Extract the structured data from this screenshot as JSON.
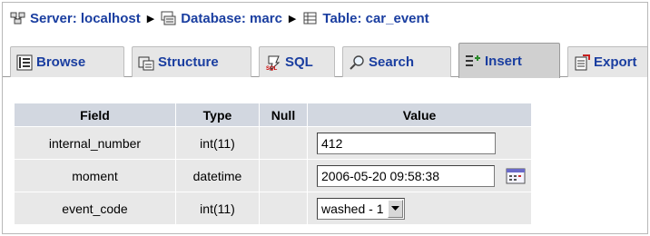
{
  "breadcrumb": {
    "server": "Server: localhost",
    "database": "Database: marc",
    "table": "Table: car_event"
  },
  "tabs": [
    {
      "label": "Browse",
      "icon": "browse-icon"
    },
    {
      "label": "Structure",
      "icon": "structure-icon"
    },
    {
      "label": "SQL",
      "icon": "sql-icon"
    },
    {
      "label": "Search",
      "icon": "search-icon"
    },
    {
      "label": "Insert",
      "icon": "insert-icon",
      "active": true
    },
    {
      "label": "Export",
      "icon": "export-icon"
    }
  ],
  "table": {
    "headers": {
      "field": "Field",
      "type": "Type",
      "null": "Null",
      "value": "Value"
    },
    "rows": [
      {
        "field": "internal_number",
        "type": "int(11)",
        "value": "412"
      },
      {
        "field": "moment",
        "type": "datetime",
        "value": "2006-05-20 09:58:38"
      },
      {
        "field": "event_code",
        "type": "int(11)",
        "value": "washed - 1"
      }
    ]
  },
  "colors": {
    "link": "#1a3ea0",
    "header_bg": "#d2d7e0",
    "cell_bg": "#e8e8e8",
    "active_tab": "#d0d0d0"
  }
}
